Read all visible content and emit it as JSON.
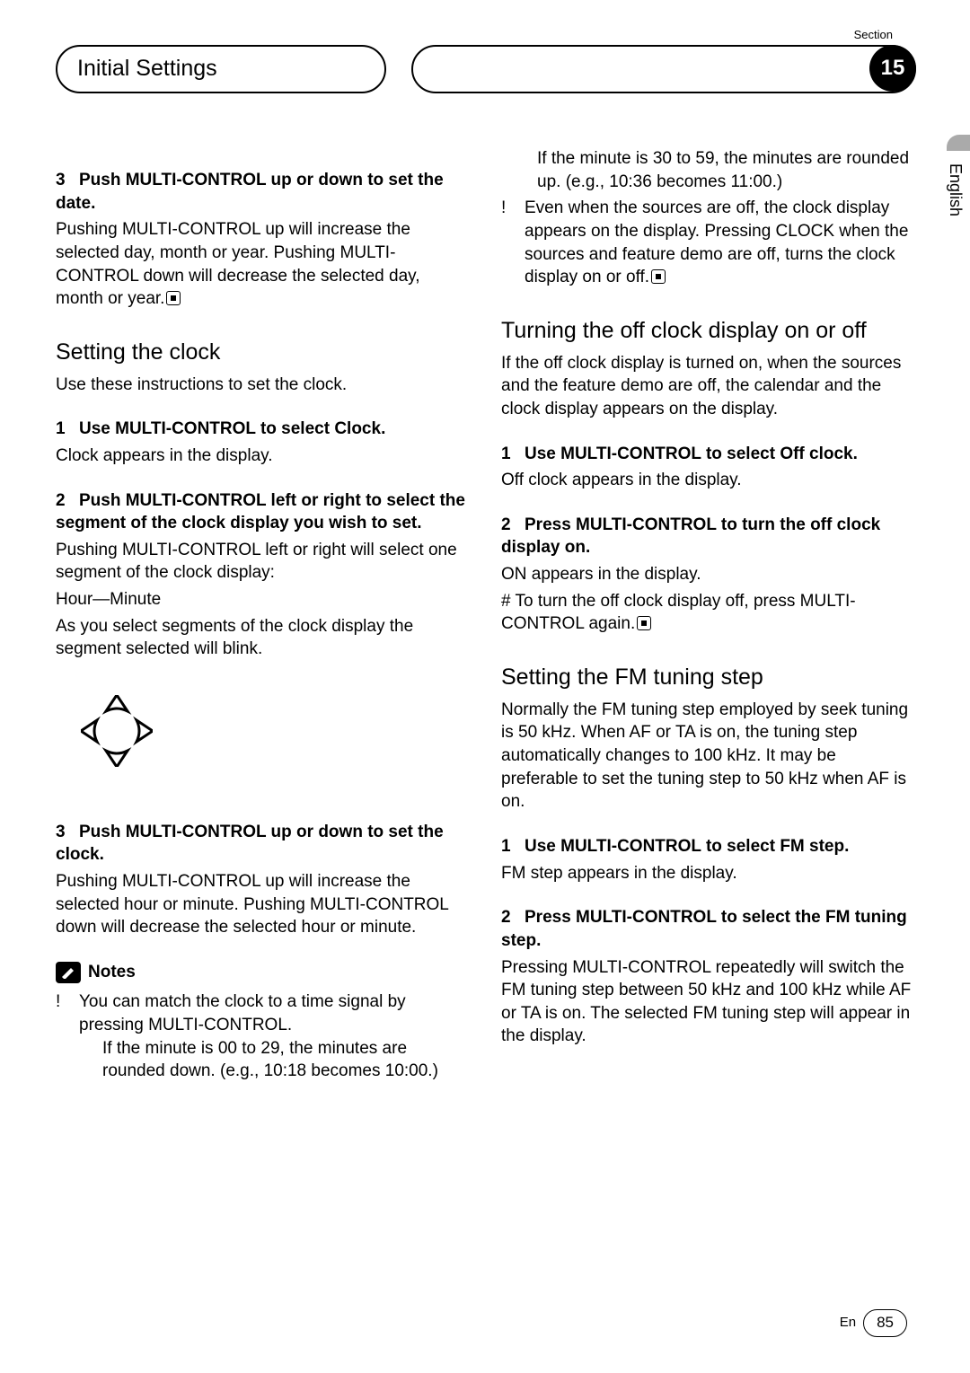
{
  "header": {
    "title": "Initial Settings",
    "section_label": "Section",
    "section_num": "15",
    "language": "English"
  },
  "left": {
    "intro_step_num": "3",
    "intro_step": "Push MULTI-CONTROL up or down to set the date.",
    "intro_body": "Pushing MULTI-CONTROL up will increase the selected day, month or year. Pushing MULTI-CONTROL down will decrease the selected day, month or year.",
    "h_clock": "Setting the clock",
    "clock_intro": "Use these instructions to set the clock.",
    "clock_s1_num": "1",
    "clock_s1": "Use MULTI-CONTROL to select Clock.",
    "clock_s1_body": "Clock appears in the display.",
    "clock_s2_num": "2",
    "clock_s2": "Push MULTI-CONTROL left or right to select the segment of the clock display you wish to set.",
    "clock_s2_body1": "Pushing MULTI-CONTROL left or right will select one segment of the clock display:",
    "clock_s2_body2": "Hour—Minute",
    "clock_s2_body3": "As you select segments of the clock display the segment selected will blink.",
    "clock_s3_num": "3",
    "clock_s3": "Push MULTI-CONTROL up or down to set the clock.",
    "clock_s3_body": "Pushing MULTI-CONTROL up will increase the selected hour or minute. Pushing MULTI-CONTROL down will decrease the selected hour or minute.",
    "notes_label": "Notes",
    "note1_mark": "!",
    "note1": "You can match the clock to a time signal by pressing MULTI-CONTROL.",
    "note1_sub1": "If the minute is 00 to 29, the minutes are rounded down. (e.g., 10:18 becomes 10:00.)"
  },
  "right": {
    "note1_sub2": "If the minute is 30 to 59, the minutes are rounded up. (e.g., 10:36 becomes 11:00.)",
    "note2_mark": "!",
    "note2": "Even when the sources are off, the clock display appears on the display. Pressing CLOCK when the sources and feature demo are off, turns the clock display on or off.",
    "h_off": "Turning the off clock display on or off",
    "off_intro": "If the off clock display is turned on, when the sources and the feature demo are off, the calendar and the clock display appears on the display.",
    "off_s1_num": "1",
    "off_s1": "Use MULTI-CONTROL to select Off clock.",
    "off_s1_body": "Off clock appears in the display.",
    "off_s2_num": "2",
    "off_s2": "Press MULTI-CONTROL to turn the off clock display on.",
    "off_s2_body1": "ON appears in the display.",
    "off_s2_body2": "# To turn the off clock display off, press MULTI-CONTROL again.",
    "h_fm": "Setting the FM tuning step",
    "fm_intro": "Normally the FM tuning step employed by seek tuning is 50 kHz. When AF or TA is on, the tuning step automatically changes to 100 kHz. It may be preferable to set the tuning step to 50 kHz when AF is on.",
    "fm_s1_num": "1",
    "fm_s1": "Use MULTI-CONTROL to select FM step.",
    "fm_s1_body": "FM step appears in the display.",
    "fm_s2_num": "2",
    "fm_s2": "Press MULTI-CONTROL to select the FM tuning step.",
    "fm_s2_body": "Pressing MULTI-CONTROL repeatedly will switch the FM tuning step between 50 kHz and 100 kHz while AF or TA is on. The selected FM tuning step will appear in the display."
  },
  "footer": {
    "lang_code": "En",
    "page_num": "85"
  }
}
